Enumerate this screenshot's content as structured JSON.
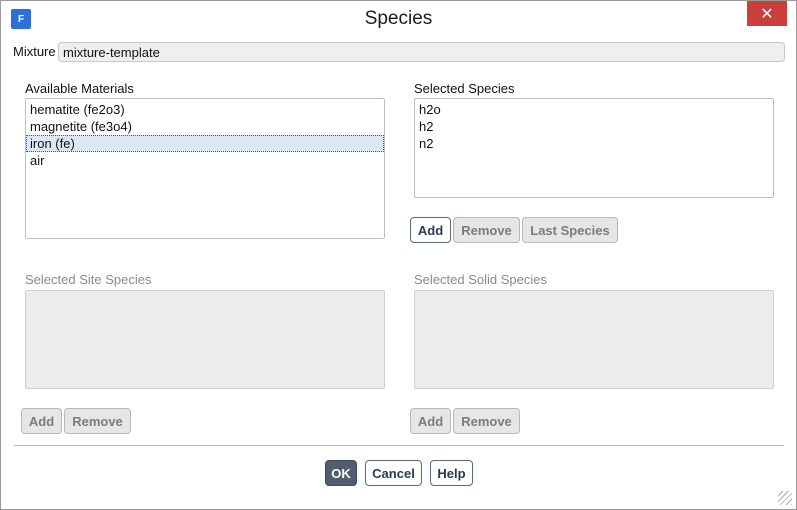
{
  "window": {
    "title": "Species",
    "app_icon": "F",
    "close_icon": "✕"
  },
  "mixture": {
    "label": "Mixture",
    "value": "mixture-template"
  },
  "available_materials": {
    "label": "Available Materials",
    "items": [
      {
        "label": "hematite (fe2o3)",
        "selected": false
      },
      {
        "label": "magnetite (fe3o4)",
        "selected": false
      },
      {
        "label": "iron (fe)",
        "selected": true
      },
      {
        "label": "air",
        "selected": false
      }
    ]
  },
  "selected_species": {
    "label": "Selected Species",
    "items": [
      "h2o",
      "h2",
      "n2"
    ],
    "buttons": {
      "add": "Add",
      "remove": "Remove",
      "last_species": "Last Species"
    }
  },
  "site_species": {
    "label": "Selected Site Species",
    "buttons": {
      "add": "Add",
      "remove": "Remove"
    }
  },
  "solid_species": {
    "label": "Selected Solid Species",
    "buttons": {
      "add": "Add",
      "remove": "Remove"
    }
  },
  "footer": {
    "ok": "OK",
    "cancel": "Cancel",
    "help": "Help"
  }
}
